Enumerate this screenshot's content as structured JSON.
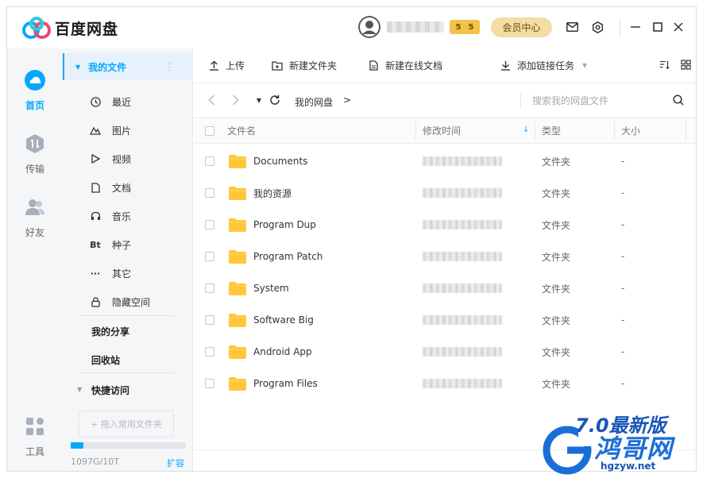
{
  "app": {
    "title": "百度网盘"
  },
  "header": {
    "vip_level": "5",
    "vip_level2": "5",
    "member_center": "会员中心"
  },
  "rail": {
    "items": [
      {
        "label": "首页",
        "icon": "cloud-icon",
        "active": true
      },
      {
        "label": "传输",
        "icon": "transfer-icon"
      },
      {
        "label": "好友",
        "icon": "friends-icon"
      }
    ],
    "tools_label": "工具"
  },
  "sidebar": {
    "my_files": "我的文件",
    "items": [
      {
        "label": "最近",
        "icon": "clock-icon"
      },
      {
        "label": "图片",
        "icon": "image-icon"
      },
      {
        "label": "视频",
        "icon": "play-icon"
      },
      {
        "label": "文档",
        "icon": "document-icon"
      },
      {
        "label": "音乐",
        "icon": "headphones-icon"
      },
      {
        "label": "种子",
        "icon": "bt-icon"
      },
      {
        "label": "其它",
        "icon": "more-icon"
      },
      {
        "label": "隐藏空间",
        "icon": "lock-icon"
      }
    ],
    "my_share": "我的分享",
    "recycle_bin": "回收站",
    "quick_access": "快捷访问",
    "drop_hint": "+ 拖入常用文件夹",
    "quota": "1097G/10T",
    "quota_fraction": 0.107,
    "expand": "扩容"
  },
  "toolbar": {
    "upload": "上传",
    "new_folder": "新建文件夹",
    "new_doc": "新建在线文档",
    "add_link_task": "添加链接任务"
  },
  "address": {
    "crumb": "我的网盘",
    "crumb_arrow": ">",
    "search_placeholder": "搜索我的网盘文件"
  },
  "table": {
    "headers": {
      "name": "文件名",
      "modified": "修改时间",
      "type": "类型",
      "size": "大小"
    },
    "rows": [
      {
        "name": "Documents",
        "type": "文件夹",
        "size": "-"
      },
      {
        "name": "我的资源",
        "type": "文件夹",
        "size": "-"
      },
      {
        "name": "Program Dup",
        "type": "文件夹",
        "size": "-"
      },
      {
        "name": "Program Patch",
        "type": "文件夹",
        "size": "-"
      },
      {
        "name": "System",
        "type": "文件夹",
        "size": "-"
      },
      {
        "name": "Software Big",
        "type": "文件夹",
        "size": "-"
      },
      {
        "name": "Android App",
        "type": "文件夹",
        "size": "-"
      },
      {
        "name": "Program Files",
        "type": "文件夹",
        "size": "-"
      }
    ]
  },
  "watermark": {
    "line1": "7.0最新版",
    "line2": "鸿哥网",
    "url": "hgzyw.net"
  },
  "colors": {
    "accent": "#06a7ff",
    "folder": "#ffc73a",
    "member_btn": "#f4dca4"
  }
}
